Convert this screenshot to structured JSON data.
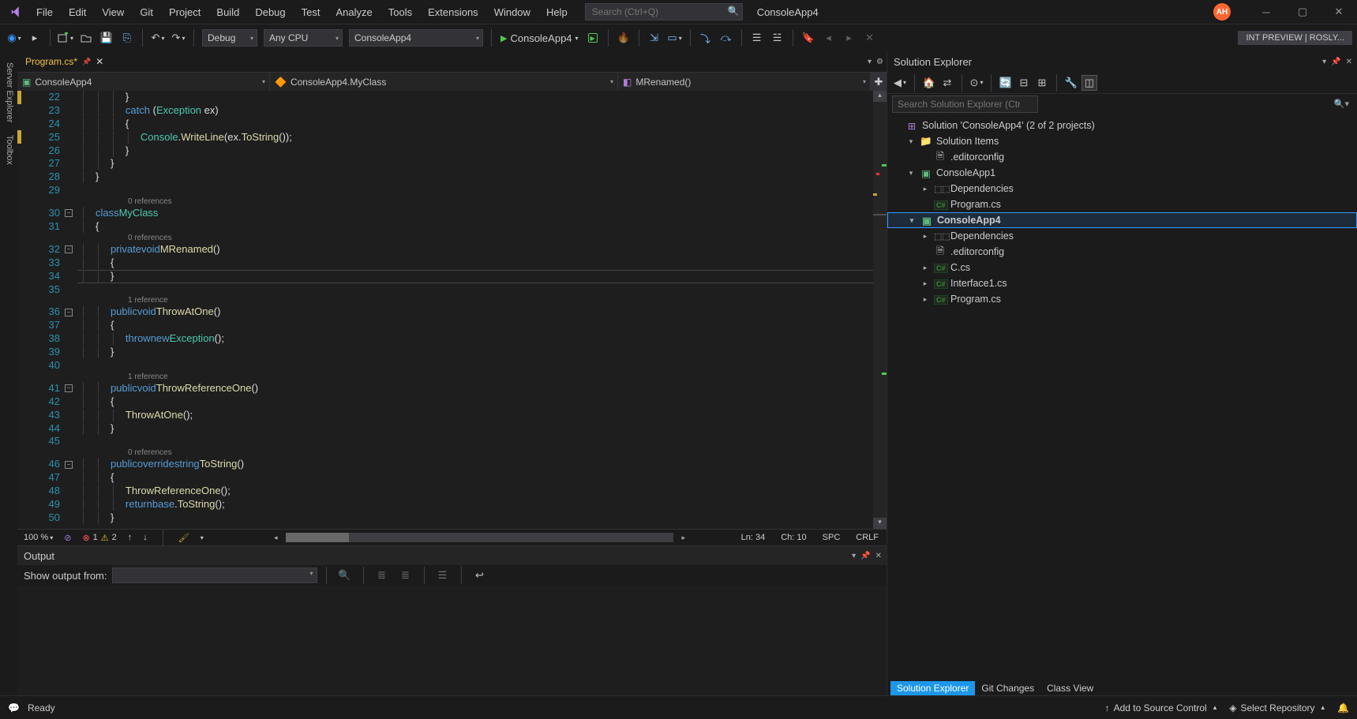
{
  "title_app": "ConsoleApp4",
  "avatar": "AH",
  "menus": [
    "File",
    "Edit",
    "View",
    "Git",
    "Project",
    "Build",
    "Debug",
    "Test",
    "Analyze",
    "Tools",
    "Extensions",
    "Window",
    "Help"
  ],
  "search_placeholder": "Search (Ctrl+Q)",
  "int_preview": "INT PREVIEW | ROSLY...",
  "toolbar": {
    "config": "Debug",
    "platform": "Any CPU",
    "startup": "ConsoleApp4",
    "start_label": "ConsoleApp4"
  },
  "side_tabs": [
    "Server Explorer",
    "Toolbox"
  ],
  "file_tab": "Program.cs*",
  "nav": {
    "scope": "ConsoleApp4",
    "type": "ConsoleApp4.MyClass",
    "member": "MRenamed()"
  },
  "codelens": {
    "zero": "0 references",
    "one": "1 reference"
  },
  "line_start": 22,
  "lines": [
    {
      "n": 22,
      "html": "            }"
    },
    {
      "n": 23,
      "html": "            <span class='kw'>catch</span> (<span class='type'>Exception</span> ex)"
    },
    {
      "n": 24,
      "html": "            {"
    },
    {
      "n": 25,
      "html": "                <span class='type'>Console</span>.<span class='method'>WriteLine</span>(ex.<span class='method'>ToString</span>());"
    },
    {
      "n": 26,
      "html": "            }"
    },
    {
      "n": 27,
      "html": "        }"
    },
    {
      "n": 28,
      "html": "    }"
    },
    {
      "n": 29,
      "html": ""
    },
    {
      "cl": "zero"
    },
    {
      "n": 30,
      "html": "    <span class='kw'>class</span> <span class='type'>MyClass</span>"
    },
    {
      "n": 31,
      "html": "    {"
    },
    {
      "cl": "zero"
    },
    {
      "n": 32,
      "html": "        <span class='kw'>private</span> <span class='kw'>void</span> <span class='method'>MRenamed</span>()"
    },
    {
      "n": 33,
      "html": "        {"
    },
    {
      "n": 34,
      "html": "        }",
      "current": true
    },
    {
      "n": 35,
      "html": ""
    },
    {
      "cl": "one"
    },
    {
      "n": 36,
      "html": "        <span class='kw'>public</span> <span class='kw'>void</span> <span class='method'>ThrowAtOne</span>()"
    },
    {
      "n": 37,
      "html": "        {"
    },
    {
      "n": 38,
      "html": "            <span class='kw'>throw</span> <span class='kw'>new</span> <span class='type'>Exception</span>();"
    },
    {
      "n": 39,
      "html": "        }"
    },
    {
      "n": 40,
      "html": ""
    },
    {
      "cl": "one"
    },
    {
      "n": 41,
      "html": "        <span class='kw'>public</span> <span class='kw'>void</span> <span class='method'>ThrowReferenceOne</span>()"
    },
    {
      "n": 42,
      "html": "        {"
    },
    {
      "n": 43,
      "html": "            <span class='method'>ThrowAtOne</span>();"
    },
    {
      "n": 44,
      "html": "        }"
    },
    {
      "n": 45,
      "html": ""
    },
    {
      "cl": "zero"
    },
    {
      "n": 46,
      "html": "        <span class='kw'>public</span> <span class='kw'>override</span> <span class='kw'>string</span> <span class='method'>ToString</span>()"
    },
    {
      "n": 47,
      "html": "        {"
    },
    {
      "n": 48,
      "html": "            <span class='method'>ThrowReferenceOne</span>();"
    },
    {
      "n": 49,
      "html": "            <span class='kw'>return</span> <span class='kw'>base</span>.<span class='method'>ToString</span>();"
    },
    {
      "n": 50,
      "html": "        }"
    }
  ],
  "editor_status": {
    "zoom": "100 %",
    "errors": "1",
    "warnings": "2",
    "ln": "Ln: 34",
    "ch": "Ch: 10",
    "ins": "SPC",
    "enc": "CRLF"
  },
  "output": {
    "title": "Output",
    "showfrom": "Show output from:"
  },
  "solution": {
    "title": "Solution Explorer",
    "search_placeholder": "Search Solution Explorer (Ctrl+;)",
    "root": "Solution 'ConsoleApp4' (2 of 2 projects)",
    "items": [
      {
        "depth": 1,
        "arrow": "▾",
        "icon": "folder",
        "label": "Solution Items"
      },
      {
        "depth": 2,
        "arrow": "",
        "icon": "file",
        "label": ".editorconfig"
      },
      {
        "depth": 1,
        "arrow": "▾",
        "icon": "proj",
        "label": "ConsoleApp1"
      },
      {
        "depth": 2,
        "arrow": "▸",
        "icon": "deps",
        "label": "Dependencies"
      },
      {
        "depth": 2,
        "arrow": "",
        "icon": "cs",
        "label": "Program.cs"
      },
      {
        "depth": 1,
        "arrow": "▾",
        "icon": "proj",
        "label": "ConsoleApp4",
        "selected": true,
        "bold": true
      },
      {
        "depth": 2,
        "arrow": "▸",
        "icon": "deps",
        "label": "Dependencies"
      },
      {
        "depth": 2,
        "arrow": "",
        "icon": "file",
        "label": ".editorconfig"
      },
      {
        "depth": 2,
        "arrow": "▸",
        "icon": "cs",
        "label": "C.cs"
      },
      {
        "depth": 2,
        "arrow": "▸",
        "icon": "cs",
        "label": "Interface1.cs"
      },
      {
        "depth": 2,
        "arrow": "▸",
        "icon": "cs",
        "label": "Program.cs"
      }
    ],
    "tabs": [
      "Solution Explorer",
      "Git Changes",
      "Class View"
    ]
  },
  "statusbar": {
    "ready": "Ready",
    "add_sc": "Add to Source Control",
    "select_repo": "Select Repository"
  }
}
